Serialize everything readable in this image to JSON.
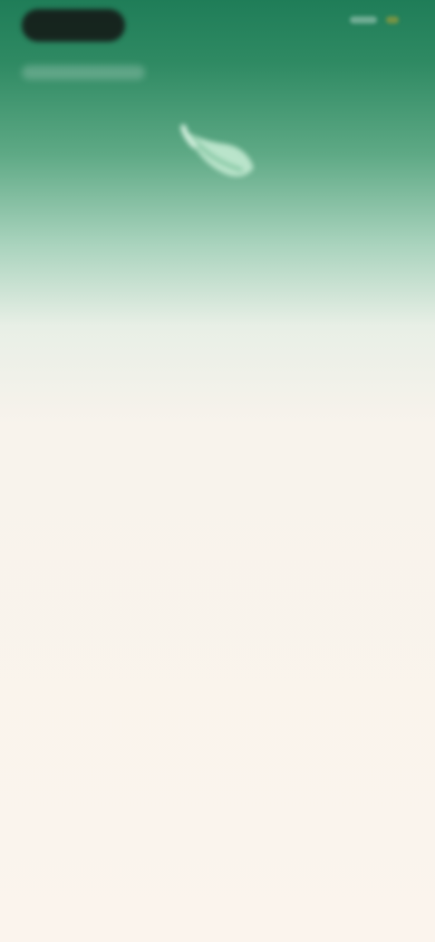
{
  "status_bar": {},
  "hero": {
    "icon": "leaf-icon"
  },
  "content": {
    "heading": "",
    "paragraphs": [
      "",
      "",
      ""
    ]
  },
  "colors": {
    "top_green": "#1f7d58",
    "background": "#fbf4ed",
    "text": "#1c1c1c"
  }
}
